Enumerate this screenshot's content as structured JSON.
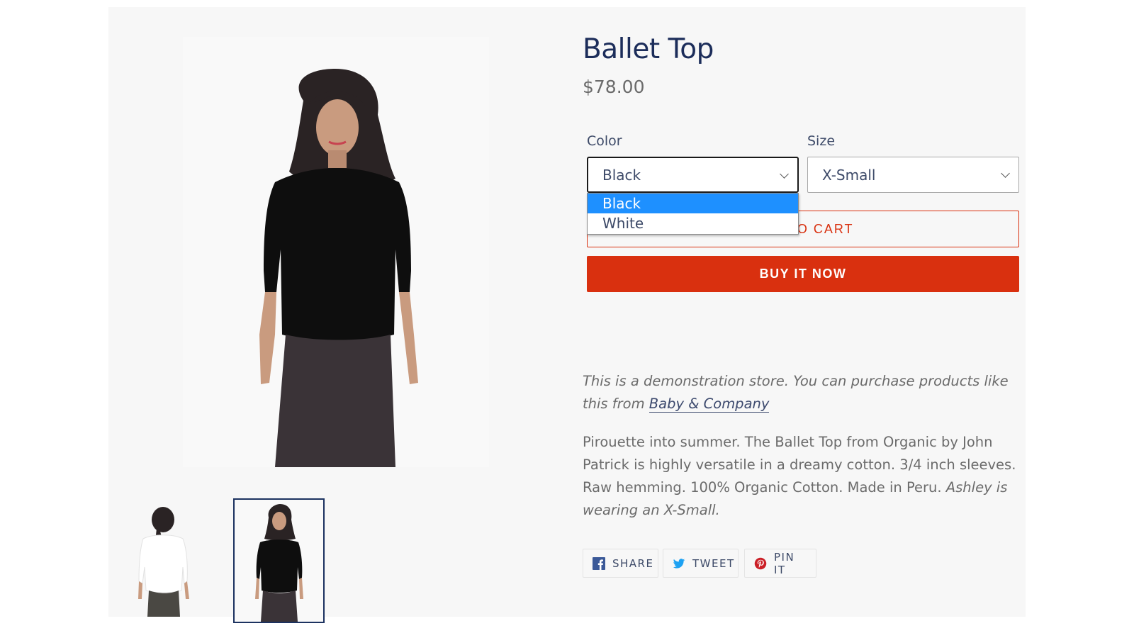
{
  "product": {
    "title": "Ballet Top",
    "price": "$78.00"
  },
  "gallery": {
    "main_image_alt": "Model wearing black Ballet Top, front view",
    "thumbnails": [
      {
        "alt": "White Ballet Top, back view",
        "selected": false
      },
      {
        "alt": "Black Ballet Top, front view",
        "selected": true
      }
    ]
  },
  "options": {
    "color": {
      "label": "Color",
      "value": "Black",
      "open": true,
      "choices": [
        "Black",
        "White"
      ],
      "highlighted": "Black"
    },
    "size": {
      "label": "Size",
      "value": "X-Small"
    }
  },
  "buttons": {
    "add_to_cart": "ADD TO CART",
    "buy_now": "BUY IT NOW"
  },
  "description": {
    "note_prefix": "This is a demonstration store. You can purchase products like this from ",
    "note_link": "Baby & Company",
    "body_main": "Pirouette into summer. The Ballet Top from Organic by John Patrick is highly versatile in a dreamy cotton. 3/4 inch sleeves. Raw hemming. 100% Organic Cotton. Made in Peru. ",
    "body_italic": "Ashley is wearing an X-Small."
  },
  "share": {
    "facebook": "SHARE",
    "twitter": "TWEET",
    "pinterest": "PIN IT"
  },
  "colors": {
    "accent": "#d9300f",
    "title": "#1c2d5a",
    "dropdown_highlight": "#1e90ff",
    "facebook": "#3b5998",
    "twitter": "#1da1f2",
    "pinterest": "#cb2027"
  }
}
